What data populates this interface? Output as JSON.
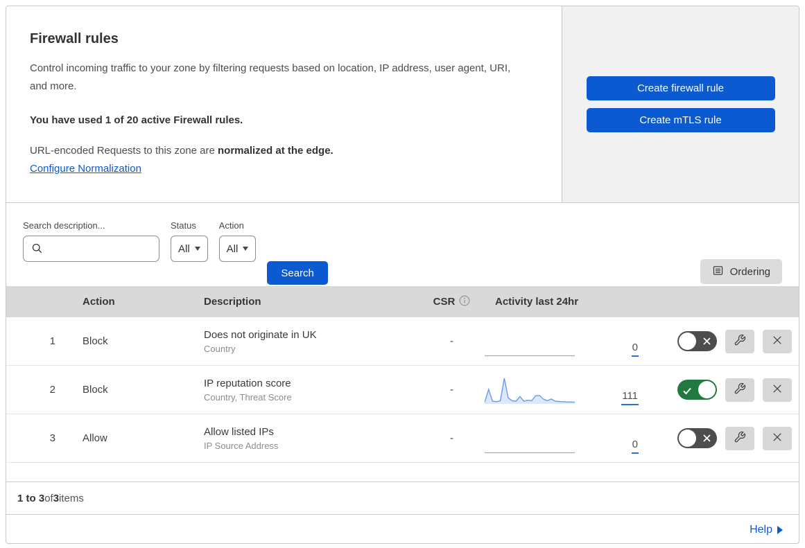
{
  "header": {
    "title": "Firewall rules",
    "description": "Control incoming traffic to your zone by filtering requests based on location, IP address, user agent, URI, and more.",
    "usage_text": "You have used 1 of 20 active Firewall rules.",
    "normalization_prefix": "URL-encoded Requests to this zone are ",
    "normalization_bold": "normalized at the edge.",
    "normalization_link": "Configure Normalization"
  },
  "side_panel": {
    "create_firewall_label": "Create firewall rule",
    "create_mtls_label": "Create mTLS rule"
  },
  "filters": {
    "search_label": "Search description...",
    "search_value": "",
    "status_label": "Status",
    "status_value": "All",
    "action_label": "Action",
    "action_value": "All",
    "search_button_label": "Search",
    "ordering_button_label": "Ordering"
  },
  "table": {
    "headers": {
      "action": "Action",
      "description": "Description",
      "csr": "CSR",
      "activity": "Activity last 24hr"
    },
    "rows": [
      {
        "index": "1",
        "action": "Block",
        "description": "Does not originate in UK",
        "fields": "Country",
        "csr": "-",
        "activity_count": "0",
        "enabled": false
      },
      {
        "index": "2",
        "action": "Block",
        "description": "IP reputation score",
        "fields": "Country, Threat Score",
        "csr": "-",
        "activity_count": "111",
        "enabled": true
      },
      {
        "index": "3",
        "action": "Allow",
        "description": "Allow listed IPs",
        "fields": "IP Source Address",
        "csr": "-",
        "activity_count": "0",
        "enabled": false
      }
    ]
  },
  "footer": {
    "range_bold": "1 to 3",
    "of_text": " of ",
    "total_bold": "3",
    "items_text": " items"
  },
  "help": {
    "label": "Help"
  },
  "colors": {
    "accent_blue": "#0b5ad1",
    "link_blue": "#0b5ad1",
    "toggle_on_green": "#21793f",
    "toggle_off_gray": "#4d4d4d",
    "sparkline_line": "#6b9aeb",
    "sparkline_fill": "#dce8f9",
    "flatline_gray": "#a9a9a9",
    "table_header_bg": "#d9d9d9",
    "side_panel_bg": "#f1f1f1"
  },
  "chart_data": [
    {
      "type": "line",
      "title": "Activity last 24hr — rule 1 (Does not originate in UK)",
      "values": [
        0,
        0,
        0,
        0,
        0,
        0,
        0,
        0,
        0,
        0,
        0,
        0,
        0,
        0,
        0,
        0,
        0,
        0,
        0,
        0,
        0,
        0,
        0,
        0
      ],
      "total_shown": 0,
      "note_units": "relative heights, no axis shown"
    },
    {
      "type": "line",
      "title": "Activity last 24hr — rule 2 (IP reputation score)",
      "values": [
        4,
        55,
        8,
        6,
        10,
        100,
        22,
        10,
        8,
        27,
        8,
        12,
        10,
        30,
        31,
        16,
        10,
        17,
        8,
        7,
        6,
        5,
        5,
        4
      ],
      "total_shown": 111,
      "note_units": "relative heights, no axis shown"
    },
    {
      "type": "line",
      "title": "Activity last 24hr — rule 3 (Allow listed IPs)",
      "values": [
        0,
        0,
        0,
        0,
        0,
        0,
        0,
        0,
        0,
        0,
        0,
        0,
        0,
        0,
        0,
        0,
        0,
        0,
        0,
        0,
        0,
        0,
        0,
        0
      ],
      "total_shown": 0,
      "note_units": "relative heights, no axis shown"
    }
  ]
}
